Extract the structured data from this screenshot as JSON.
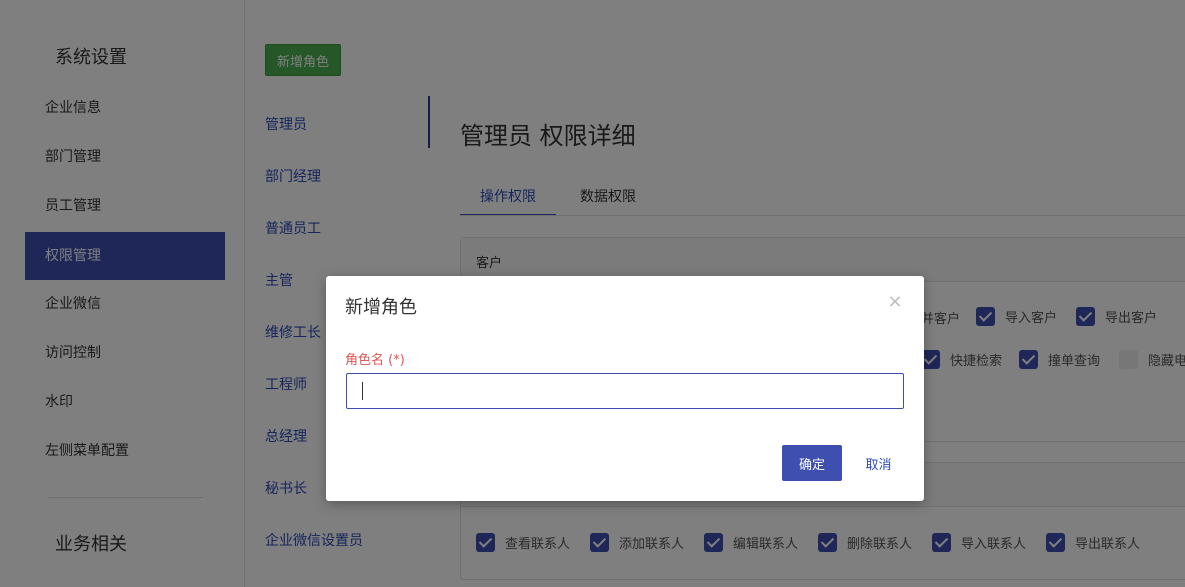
{
  "sidebar": {
    "title": "系统设置",
    "items": [
      {
        "label": "企业信息"
      },
      {
        "label": "部门管理"
      },
      {
        "label": "员工管理"
      },
      {
        "label": "权限管理"
      },
      {
        "label": "企业微信"
      },
      {
        "label": "访问控制"
      },
      {
        "label": "水印"
      },
      {
        "label": "左侧菜单配置"
      }
    ],
    "active_index": 3,
    "section2_title": "业务相关"
  },
  "roles": {
    "add_button": "新增角色",
    "items": [
      "管理员",
      "部门经理",
      "普通员工",
      "主管",
      "维修工长",
      "工程师",
      "总经理",
      "秘书长",
      "企业微信设置员"
    ]
  },
  "detail": {
    "title": "管理员 权限详细",
    "tabs": [
      "操作权限",
      "数据权限"
    ],
    "panel1": {
      "header": "客户",
      "row1": [
        "并客户",
        "导入客户",
        "导出客户"
      ],
      "row2": [
        "快捷检索",
        "撞单查询",
        "隐藏电"
      ]
    },
    "panel2": {
      "row1": [
        "查看联系人",
        "添加联系人",
        "编辑联系人",
        "删除联系人",
        "导入联系人",
        "导出联系人"
      ]
    }
  },
  "modal": {
    "title": "新增角色",
    "close_icon": "×",
    "field_label": "角色名 (*)",
    "field_value": "",
    "confirm_label": "确定",
    "cancel_label": "取消"
  },
  "colors": {
    "primary": "#3f4fb0",
    "success": "#4caf50",
    "required": "#e05555"
  }
}
